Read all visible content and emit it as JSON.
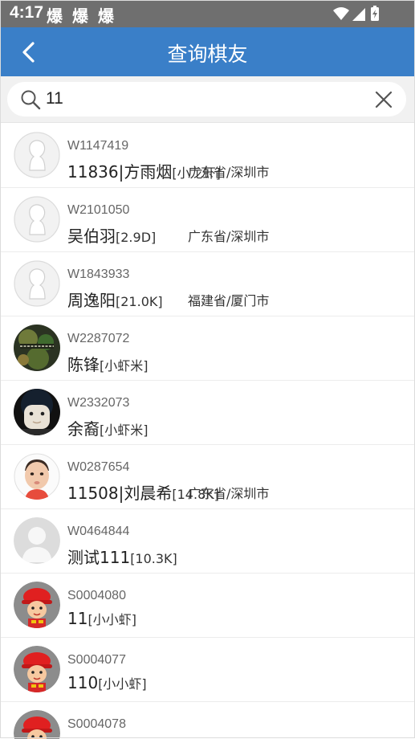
{
  "status_bar": {
    "time": "4:17",
    "notifications": [
      "爆",
      "爆",
      "爆"
    ]
  },
  "header": {
    "title": "查询棋友"
  },
  "search": {
    "value": "11"
  },
  "players": [
    {
      "id": "W1147419",
      "name": "11836|方雨烟",
      "rank": "[小龙虾]",
      "location": "广东省/深圳市",
      "avatar": "default-avatar"
    },
    {
      "id": "W2101050",
      "name": "吴伯羽",
      "rank": "[2.9D]",
      "location": "广东省/深圳市",
      "avatar": "default-avatar"
    },
    {
      "id": "W1843933",
      "name": "周逸阳",
      "rank": "[21.0K]",
      "location": "福建省/厦门市",
      "avatar": "default-avatar"
    },
    {
      "id": "W2287072",
      "name": "陈锋",
      "rank": "[小虾米]",
      "location": "",
      "avatar": "bacteria-photo"
    },
    {
      "id": "W2332073",
      "name": "余裔",
      "rank": "[小虾米]",
      "location": "",
      "avatar": "cartoon-face"
    },
    {
      "id": "W0287654",
      "name": "11508|刘晨希",
      "rank": "[14.8K]",
      "location": "广东省/深圳市",
      "avatar": "baby-photo"
    },
    {
      "id": "W0464844",
      "name": "测试111",
      "rank": "[10.3K]",
      "location": "",
      "avatar": "gray-silhouette"
    },
    {
      "id": "S0004080",
      "name": "11",
      "rank": "[小小虾]",
      "location": "",
      "avatar": "firefighter-cartoon"
    },
    {
      "id": "S0004077",
      "name": "110",
      "rank": "[小小虾]",
      "location": "",
      "avatar": "firefighter-cartoon"
    },
    {
      "id": "S0004078",
      "name": "",
      "rank": "",
      "location": "",
      "avatar": "firefighter-cartoon"
    }
  ]
}
